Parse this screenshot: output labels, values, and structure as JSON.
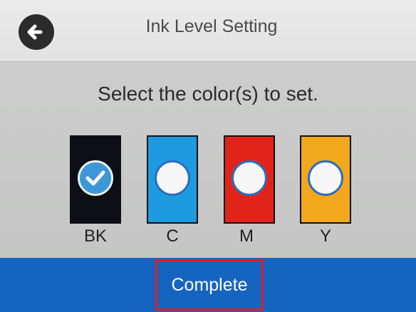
{
  "header": {
    "title": "Ink Level Setting",
    "back_icon": "arrow-left-icon"
  },
  "instruction": "Select the color(s) to set.",
  "inks": [
    {
      "label": "BK",
      "color": "#0e0e16",
      "selected": true
    },
    {
      "label": "C",
      "color": "#1e9be0",
      "selected": false
    },
    {
      "label": "M",
      "color": "#e2231a",
      "selected": false
    },
    {
      "label": "Y",
      "color": "#f2a81d",
      "selected": false
    }
  ],
  "footer": {
    "complete_label": "Complete",
    "bar_color": "#1565c0",
    "highlight_color": "#e01e2a"
  }
}
